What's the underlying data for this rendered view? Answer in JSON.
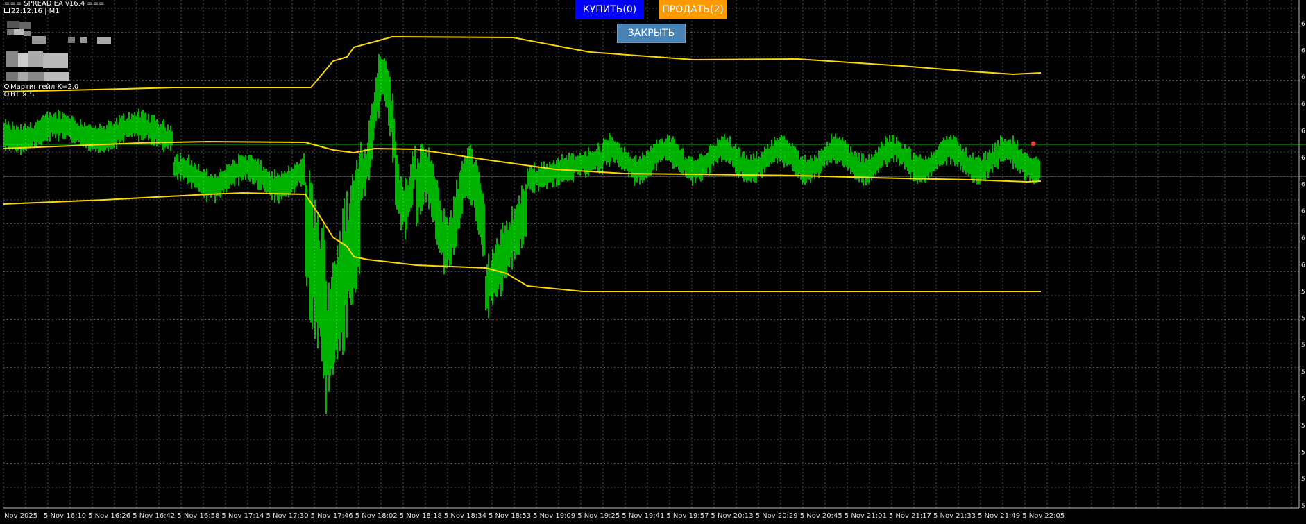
{
  "ea": {
    "title": "=== SPREAD EA v16.4 ===",
    "time_line": "22:12:16 | M1",
    "martingale": "Мартингейл K=2.0",
    "bt_sl": "BT × SL"
  },
  "buttons": {
    "buy": "КУПИТЬ(0)",
    "sell": "ПРОДАТЬ(2)",
    "close": "ЗАКРЫТЬ"
  },
  "colors": {
    "background": "#000000",
    "grid": "#c0c0c0",
    "candles": "#00ff00",
    "bands": "#ffd700",
    "level_line": "#00c000",
    "marker": "#ff3030",
    "buy_button": "#0000ff",
    "sell_button": "#ff9900",
    "close_button": "#4682b4"
  },
  "x_axis": {
    "labels": [
      "Nov 2025",
      "5 Nov 16:10",
      "5 Nov 16:26",
      "5 Nov 16:42",
      "5 Nov 16:58",
      "5 Nov 17:14",
      "5 Nov 17:30",
      "5 Nov 17:46",
      "5 Nov 18:02",
      "5 Nov 18:18",
      "5 Nov 18:34",
      "5 Nov 18:53",
      "5 Nov 19:09",
      "5 Nov 19:25",
      "5 Nov 19:41",
      "5 Nov 19:57",
      "5 Nov 20:13",
      "5 Nov 20:29",
      "5 Nov 20:45",
      "5 Nov 21:01",
      "5 Nov 21:17",
      "5 Nov 21:33",
      "5 Nov 21:49",
      "5 Nov 22:05"
    ]
  },
  "y_axis": {
    "labels": [
      "6",
      "6",
      "6",
      "6",
      "6",
      "6",
      "6",
      "6",
      "6",
      "6",
      "5",
      "5",
      "5",
      "5",
      "5",
      "5",
      "5",
      "5",
      "5"
    ]
  }
}
